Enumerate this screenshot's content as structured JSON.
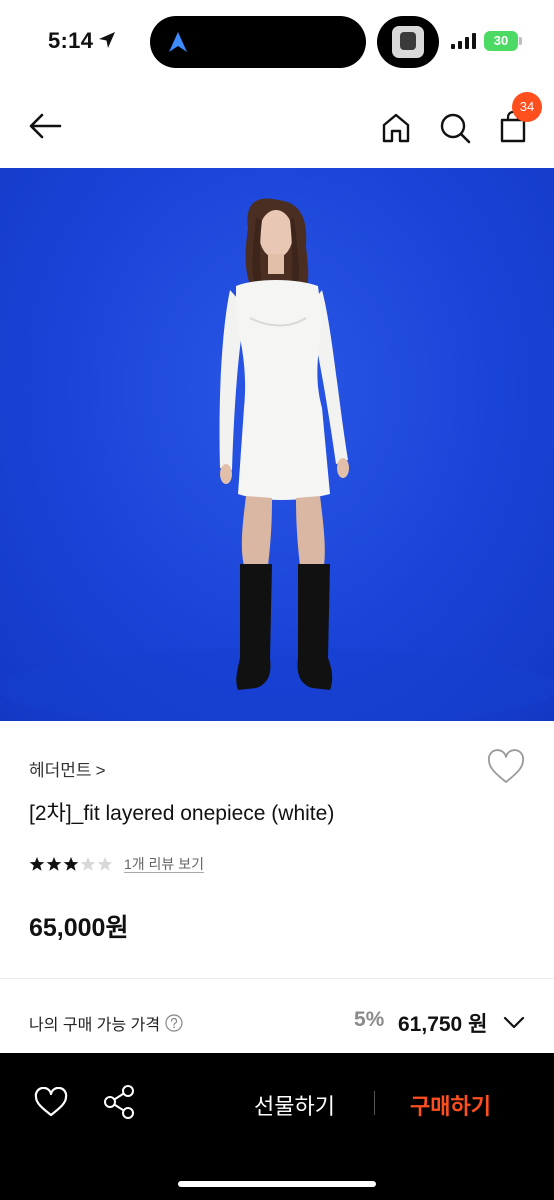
{
  "status_bar": {
    "time": "5:14",
    "battery": "30"
  },
  "header": {
    "cart_count": "34"
  },
  "product": {
    "brand": "헤더먼트",
    "brand_chevron": ">",
    "title": "[2차]_fit layered onepiece (white)",
    "rating": 3,
    "rating_max": 5,
    "review_link": "1개 리뷰 보기",
    "price": "65,000원"
  },
  "purchase_price": {
    "label": "나의 구매 가능 가격",
    "discount": "5%",
    "price": "61,750 원"
  },
  "bottom_bar": {
    "gift_label": "선물하기",
    "buy_label": "구매하기"
  },
  "colors": {
    "accent": "#ff4f1f",
    "hero_background": "#1a44d8",
    "bottom_bar": "#000000"
  },
  "icons": [
    "location-arrow-icon",
    "app-logo-icon",
    "back-arrow-icon",
    "home-icon",
    "search-icon",
    "shopping-bag-icon",
    "heart-icon",
    "star-icon",
    "help-circle-icon",
    "chevron-down-icon",
    "share-icon"
  ]
}
